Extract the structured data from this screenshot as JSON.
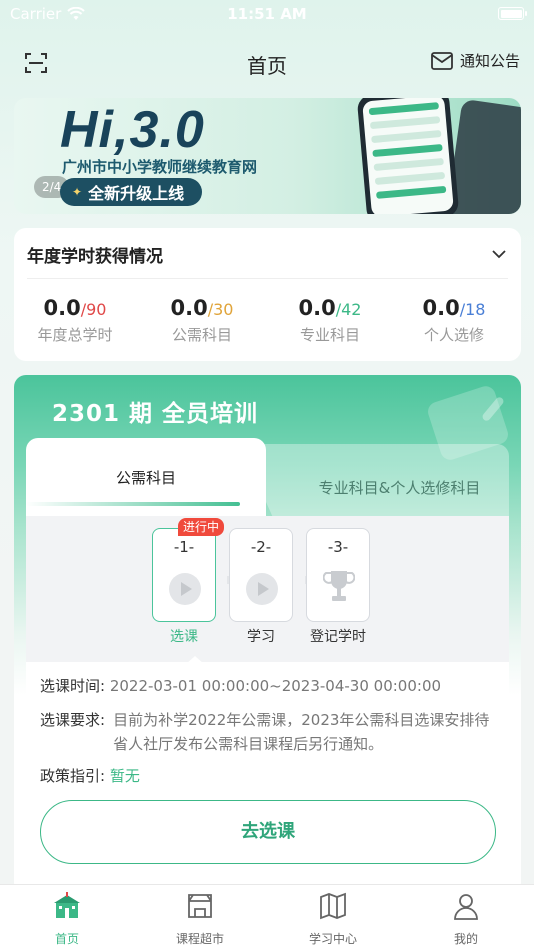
{
  "status_bar": {
    "carrier": "Carrier",
    "time": "11:51 AM"
  },
  "nav": {
    "title": "首页",
    "notice": "通知公告"
  },
  "banner": {
    "headline": "Hi,3.0",
    "subtitle": "广州市中小学教师继续教育网",
    "tagline": "全新升级上线",
    "counter": "2/4"
  },
  "stats": {
    "title": "年度学时获得情况",
    "items": [
      {
        "value": "0.0",
        "max": "/90",
        "label": "年度总学时",
        "color": "#e04848"
      },
      {
        "value": "0.0",
        "max": "/30",
        "label": "公需科目",
        "color": "#e0a43a"
      },
      {
        "value": "0.0",
        "max": "/42",
        "label": "专业科目",
        "color": "#3cb887"
      },
      {
        "value": "0.0",
        "max": "/18",
        "label": "个人选修",
        "color": "#4a7fd6"
      }
    ]
  },
  "training": {
    "title": "2301 期 全员培训",
    "tabs": [
      "公需科目",
      "专业科目&个人选修科目"
    ],
    "status_badge": "进行中",
    "steps": [
      {
        "num": "-1-",
        "label": "选课"
      },
      {
        "num": "-2-",
        "label": "学习"
      },
      {
        "num": "-3-",
        "label": "登记学时"
      }
    ],
    "info": {
      "time_key": "选课时间:",
      "time_value": "2022-03-01 00:00:00~2023-04-30 00:00:00",
      "req_key": "选课要求:",
      "req_value": "目前为补学2022年公需课，2023年公需科目选课安排待省人社厅发布公需科目课程后另行通知。",
      "policy_key": "政策指引:",
      "policy_value": "暂无"
    },
    "button": "去选课"
  },
  "tab_bar": [
    "首页",
    "课程超市",
    "学习中心",
    "我的"
  ],
  "colors": {
    "accent": "#3cb887",
    "badge": "#f04a3c"
  }
}
